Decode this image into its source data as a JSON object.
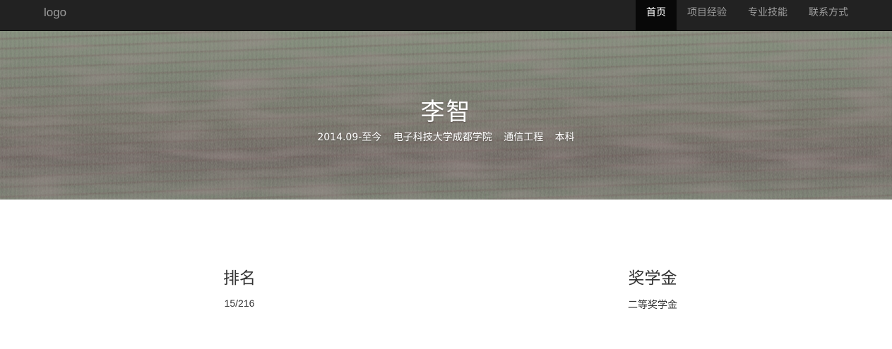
{
  "navbar": {
    "logo": "logo",
    "items": [
      {
        "label": "首页",
        "active": true
      },
      {
        "label": "项目经验",
        "active": false
      },
      {
        "label": "专业技能",
        "active": false
      },
      {
        "label": "联系方式",
        "active": false
      }
    ]
  },
  "hero": {
    "name": "李智",
    "info": {
      "period": "2014.09-至今",
      "school": "电子科技大学成都学院",
      "major": "通信工程",
      "degree": "本科"
    }
  },
  "stats": {
    "rank": {
      "title": "排名",
      "value": "15/216"
    },
    "scholarship": {
      "title": "奖学金",
      "value": "二等奖学金"
    }
  },
  "colors": {
    "navbar_bg": "#222222",
    "nav_active_bg": "#080808",
    "nav_text": "#9d9d9d",
    "text": "#333333"
  }
}
